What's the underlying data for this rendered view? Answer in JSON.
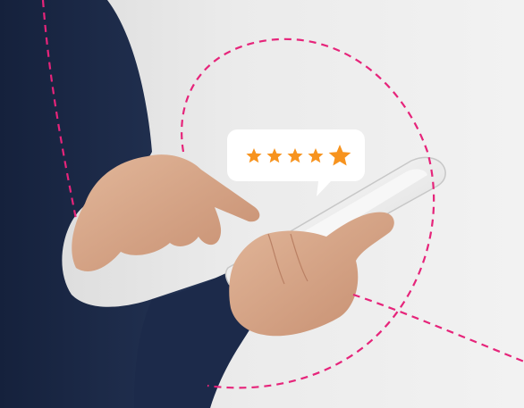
{
  "photo": {
    "subject": "person-holding-smartphone-with-rating-bubble"
  },
  "rating_bubble": {
    "icon": "star-icon",
    "stars_filled": 5,
    "stars_total": 5,
    "star_color": "#f7931e",
    "bubble_color": "#ffffff"
  },
  "decoration": {
    "dashed_line_color": "#e6247a",
    "background_color": "#ececec",
    "sweater_color": "#1f2d4e"
  }
}
